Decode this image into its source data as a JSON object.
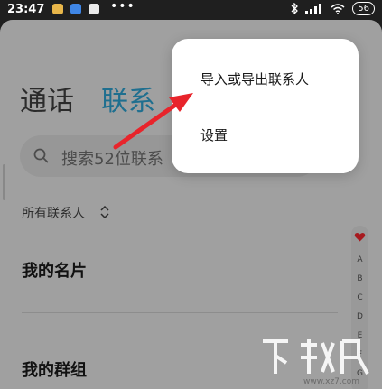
{
  "status_bar": {
    "time": "23:47",
    "dots": "•••",
    "battery": "56"
  },
  "tabs": {
    "call": "通话",
    "contacts": "联系"
  },
  "search": {
    "placeholder": "搜索52位联系"
  },
  "filter": {
    "label": "所有联系人"
  },
  "sections": {
    "my_card": "我的名片",
    "my_groups": "我的群组"
  },
  "alpha_index": [
    "A",
    "B",
    "C",
    "D",
    "E",
    "F",
    "G"
  ],
  "menu": {
    "import_export": "导入或导出联系人",
    "settings": "设置"
  },
  "colors": {
    "accent": "#2b9ac7",
    "arrow": "#e8242b"
  },
  "watermark": {
    "url": "www.xz7.com"
  }
}
